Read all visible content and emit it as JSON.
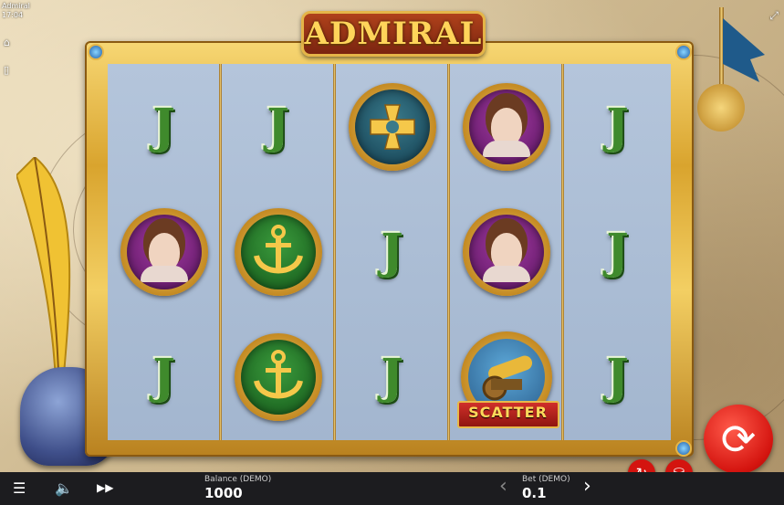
{
  "system": {
    "app_name": "Admiral",
    "time": "17:04"
  },
  "game": {
    "title": "ADMIRAL"
  },
  "reels": [
    [
      "J",
      "lady",
      "J"
    ],
    [
      "J",
      "anchor",
      "anchor"
    ],
    [
      "cross",
      "J",
      "J"
    ],
    [
      "lady",
      "lady",
      "scatter"
    ],
    [
      "J",
      "J",
      "J"
    ]
  ],
  "symbols": {
    "letter_j": "J",
    "scatter_label": "SCATTER"
  },
  "controls": {
    "menu_icon": "menu-icon",
    "sound_icon": "sound-icon",
    "turbo_icon": "fast-forward-icon",
    "balance_label": "Balance (DEMO)",
    "balance_value": "1000",
    "bet_label": "Bet (DEMO)",
    "bet_value": "0.1",
    "bet_decrease": "‹",
    "bet_increase": "›",
    "autoplay_icon": "autoplay-icon",
    "coins_icon": "coins-settings-icon",
    "spin_icon": "spin-icon"
  },
  "colors": {
    "spin": "#d4140f",
    "gold": "#e5b548",
    "reel_bg": "#a9bbd2",
    "j_green": "#3f8a2c"
  }
}
